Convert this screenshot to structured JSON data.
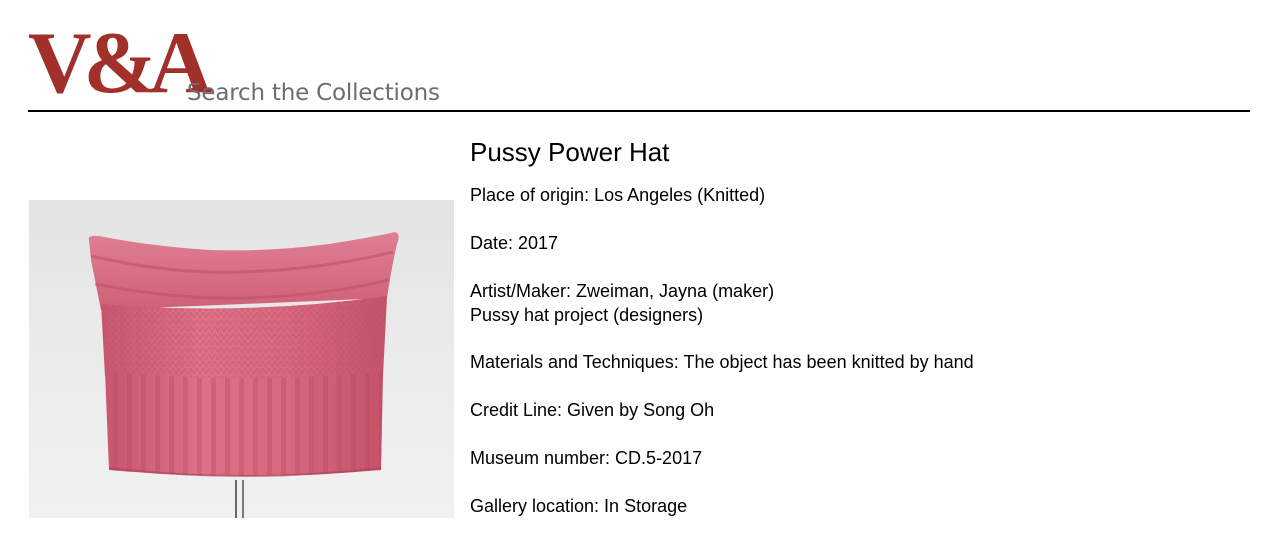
{
  "header": {
    "logo_text": "V&A",
    "site_title": "Search the Collections"
  },
  "object": {
    "title": "Pussy Power Hat",
    "image_alt": "Pink hand-knitted hat with cat-ear corners on a display stand",
    "fields": {
      "place_of_origin": "Place of origin: Los Angeles (Knitted)",
      "date": "Date: 2017",
      "artist_maker_line1": "Artist/Maker: Zweiman, Jayna (maker)",
      "artist_maker_line2": "Pussy hat project (designers)",
      "materials": "Materials and Techniques: The object has been knitted by hand",
      "credit_line": "Credit Line: Given by Song Oh",
      "museum_number": "Museum number: CD.5-2017",
      "gallery_location": "Gallery location: In Storage"
    }
  },
  "colors": {
    "logo_red": "#a1302a",
    "site_title_gray": "#6d6d6d",
    "hat_pink": "#d66b80"
  }
}
